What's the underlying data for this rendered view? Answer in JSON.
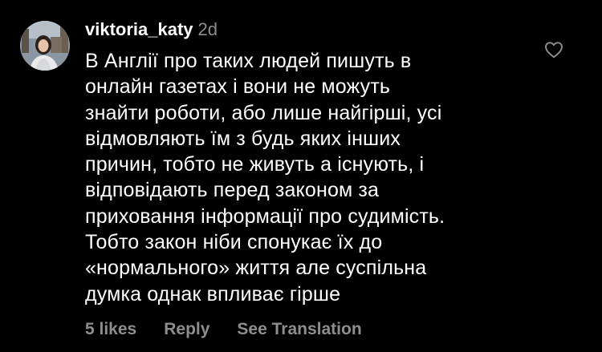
{
  "comment": {
    "username": "viktoria_katy",
    "timestamp": "2d",
    "text": "В Англії про таких людей пишуть в\nонлайн газетах і вони не можуть\nзнайти роботи, або лише найгірші, усі\nвідмовляють їм з будь яких інших\nпричин, тобто не живуть а існують, і\nвідповідають перед законом за\nприховання інформації про судимість.\nТобто закон ніби спонукає їх до\n«нормального» життя але суспільна\nдумка однак впливає гірше",
    "likes": "5 likes",
    "reply_label": "Reply",
    "translate_label": "See Translation",
    "like_icon": "heart-outline-icon"
  },
  "colors": {
    "background": "#000000",
    "primary_text": "#ffffff",
    "secondary_text": "#8e8e8e"
  }
}
